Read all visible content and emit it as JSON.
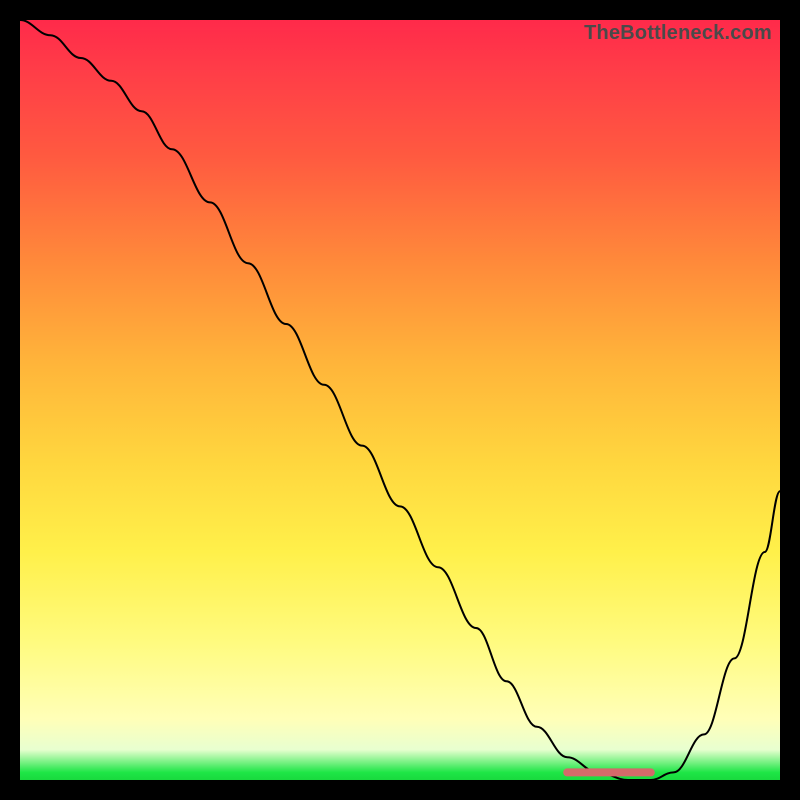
{
  "watermark_text": "TheBottleneck.com",
  "chart_data": {
    "type": "line",
    "title": "",
    "xlabel": "",
    "ylabel": "",
    "xlim": [
      0,
      100
    ],
    "ylim": [
      0,
      100
    ],
    "x": [
      0,
      4,
      8,
      12,
      16,
      20,
      25,
      30,
      35,
      40,
      45,
      50,
      55,
      60,
      64,
      68,
      72,
      76,
      80,
      83,
      86,
      90,
      94,
      98,
      100
    ],
    "values": [
      100,
      98,
      95,
      92,
      88,
      83,
      76,
      68,
      60,
      52,
      44,
      36,
      28,
      20,
      13,
      7,
      3,
      1,
      0,
      0,
      1,
      6,
      16,
      30,
      38
    ],
    "flat_segment": {
      "x_start": 72,
      "x_end": 83,
      "y": 1
    },
    "flat_segment_color": "#d46a6a",
    "curve_color": "#000000",
    "gradient_stops": [
      {
        "pos": 0.0,
        "color": "#ff2a4a"
      },
      {
        "pos": 0.32,
        "color": "#ff8a3a"
      },
      {
        "pos": 0.7,
        "color": "#fff04a"
      },
      {
        "pos": 0.96,
        "color": "#e8ffd0"
      },
      {
        "pos": 1.0,
        "color": "#19d93e"
      }
    ]
  }
}
